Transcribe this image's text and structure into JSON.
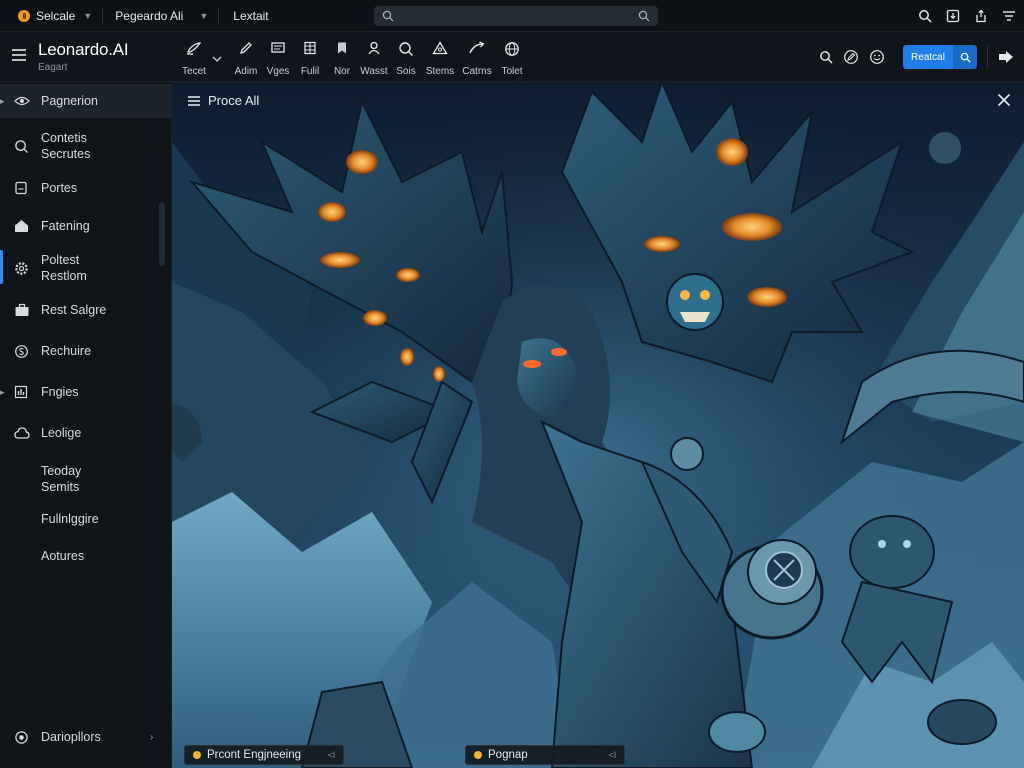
{
  "topbar": {
    "tabs": [
      {
        "label": "Selcale"
      },
      {
        "label": "Pegeardo Ali"
      },
      {
        "label": "Lextait"
      }
    ],
    "search": {
      "placeholder": ""
    }
  },
  "app": {
    "title": "Leonardo.AI",
    "subtitle": "Eagart"
  },
  "toolbar": {
    "tools": [
      {
        "label": "Tecet",
        "icon": "brush-icon"
      },
      {
        "label": "Adim",
        "icon": "pencil-icon"
      },
      {
        "label": "Vges",
        "icon": "frame-icon"
      },
      {
        "label": "Fulil",
        "icon": "grid-icon"
      },
      {
        "label": "Nor",
        "icon": "bookmark-icon"
      },
      {
        "label": "Wasst",
        "icon": "person-icon"
      },
      {
        "label": "Sois",
        "icon": "search-icon"
      },
      {
        "label": "Stems",
        "icon": "triangle-icon"
      },
      {
        "label": "Catrns",
        "icon": "arrow-icon"
      },
      {
        "label": "Tolet",
        "icon": "globe-icon"
      }
    ],
    "primary_button": "Reatcal"
  },
  "sidebar": {
    "items": [
      {
        "label": "Pagnerion",
        "icon": "eye-icon"
      },
      {
        "label": "Contetis",
        "label2": "Secrutes",
        "icon": "search-icon"
      },
      {
        "label": "Portes",
        "icon": "document-icon"
      },
      {
        "label": "Fatening",
        "icon": "home-icon"
      },
      {
        "label": "Poltest",
        "label2": "Restlom",
        "icon": "gear-icon"
      },
      {
        "label": "Rest Salgre",
        "icon": "briefcase-icon"
      },
      {
        "label": "Rechuire",
        "icon": "dollar-icon"
      },
      {
        "label": "Fngies",
        "icon": "chart-icon"
      },
      {
        "label": "Leolige",
        "icon": "cloud-icon"
      },
      {
        "label": "Teoday",
        "label2": "Semits"
      },
      {
        "label": "Fullnlggire"
      },
      {
        "label": "Aotures"
      }
    ],
    "footer": {
      "label": "Dariopllors",
      "icon": "sun-icon"
    }
  },
  "canvas": {
    "title": "Proce All",
    "chips": [
      {
        "label": "Prcont Engjneeing",
        "count": "<l"
      },
      {
        "label": "Pognap",
        "count": "<l"
      }
    ]
  },
  "colors": {
    "accent": "#1f7ee8",
    "sidebar_accent": "#2f8cff",
    "orange": "#f59a23"
  }
}
